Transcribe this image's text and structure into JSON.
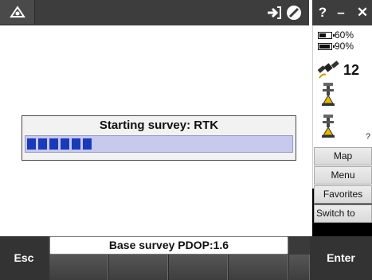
{
  "topbar": {
    "help_label": "?",
    "minimize_label": "–",
    "close_label": "✕"
  },
  "dialog": {
    "title": "Starting survey: RTK",
    "progress_blocks": 6
  },
  "status_panel": {
    "battery_1": "60%",
    "battery_1_level": 0.6,
    "battery_2": "90%",
    "battery_2_level": 0.9,
    "satellites": "12",
    "truncated_text": "?"
  },
  "side_buttons": {
    "map": "Map",
    "menu": "Menu",
    "favorites": "Favorites",
    "switch_to": "Switch to"
  },
  "status_bar": {
    "text": "Base survey  PDOP:1.6"
  },
  "softkeys": {
    "esc": "Esc",
    "enter": "Enter"
  },
  "colors": {
    "progress_fill": "#1b3ab8",
    "progress_track": "#c6c8ec"
  }
}
